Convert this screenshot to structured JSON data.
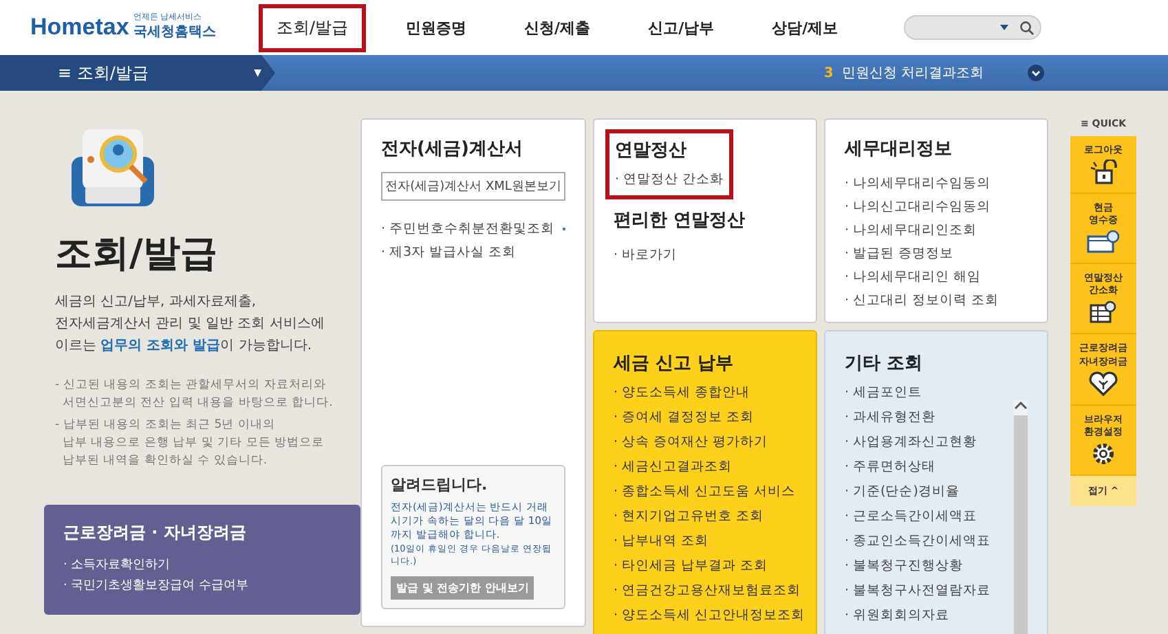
{
  "header": {
    "logo_tagline": "언제든 납세서비스",
    "logo_text": "Hometax",
    "logo_org": "국세청홈택스",
    "nav": [
      {
        "label": "조회/발급",
        "selected": true
      },
      {
        "label": "민원증명",
        "selected": false
      },
      {
        "label": "신청/제출",
        "selected": false
      },
      {
        "label": "신고/납부",
        "selected": false
      },
      {
        "label": "상담/제보",
        "selected": false
      }
    ]
  },
  "subbar": {
    "menu_glyph": "≡",
    "title": "조회/발급",
    "caret": "▼",
    "notice_count": "3",
    "notice_label": "민원신청 처리결과조회"
  },
  "intro": {
    "title": "조회/발급",
    "description": "세금의 신고/납부, 과세자료제출,\n전자세금계산서 관리 및 일반 조회 서비스에\n이르는 **업무의 조회와 발급**이 가능합니다.",
    "notes": [
      "- 신고된 내용의 조회는 관할세무서의 자료처리와\n  서면신고분의 전산 입력 내용을 바탕으로 합니다.",
      "- 납부된 내용의 조회는 최근 5년 이내의\n  납부 내용으로 은행 납부 및 기타 모든 방법으로\n  납부된 내역을 확인하실 수 있습니다."
    ]
  },
  "promo": {
    "title": "근로장려금 · 자녀장려금",
    "items": [
      "· 소득자료확인하기",
      "· 국민기초생활보장급여 수급여부"
    ]
  },
  "einvoice": {
    "title": "전자(세금)계산서",
    "button": "전자(세금)계산서 XML원본보기",
    "links": [
      "· 주민번호수취분전환및조회",
      "· 제3자 발급사실 조회"
    ],
    "notice": {
      "title": "알려드립니다.",
      "text": "전자(세금)계산서는 반드시 거래시기가 속하는 달의 다음 달 10일까지 발급해야 합니다.",
      "subtext": "(10일이 휴일인 경우 다음날로 연장됩니다.)",
      "button": "발급 및 전송기한 안내보기"
    }
  },
  "year_end": {
    "title": "연말정산",
    "highlighted": true,
    "links": [
      "· 연말정산 간소화"
    ],
    "title2": "편리한 연말정산",
    "links2": [
      "· 바로가기"
    ]
  },
  "agent": {
    "title": "세무대리정보",
    "links": [
      "· 나의세무대리수임동의",
      "· 나의신고대리수임동의",
      "· 나의세무대리인조회",
      "· 발급된 증명정보",
      "· 나의세무대리인 해임",
      "· 신고대리 정보이력 조회"
    ]
  },
  "tax_filing": {
    "title": "세금 신고 납부",
    "links": [
      "· 양도소득세 종합안내",
      "· 증여세 결정정보 조회",
      "· 상속 증여재산 평가하기",
      "· 세금신고결과조회",
      "· 종합소득세 신고도움 서비스",
      "· 현지기업고유번호 조회",
      "· 납부내역 조회",
      "· 타인세금 납부결과 조회",
      "· 연금건강고용산재보험료조회",
      "· 양도소득세 신고안내정보조회"
    ]
  },
  "other": {
    "title": "기타 조회",
    "links": [
      "· 세금포인트",
      "· 과세유형전환",
      "· 사업용계좌신고현황",
      "· 주류면허상태",
      "· 기준(단순)경비율",
      "· 근로소득간이세액표",
      "· 종교인소득간이세액표",
      "· 불복청구진행상황",
      "· 불복청구사전열람자료",
      "· 위원회회의자료"
    ]
  },
  "quick": {
    "title": "≡ QUICK",
    "items": [
      {
        "label": "로그아웃",
        "kind": "lock"
      },
      {
        "label": "현금\n영수증",
        "kind": "receipt"
      },
      {
        "label": "연말정산\n간소화",
        "kind": "table"
      },
      {
        "label": "근로장려금\n자녀장려금",
        "kind": "heart"
      },
      {
        "label": "브라우저\n환경설정",
        "kind": "gear"
      }
    ],
    "collapse": "접기 ^"
  }
}
